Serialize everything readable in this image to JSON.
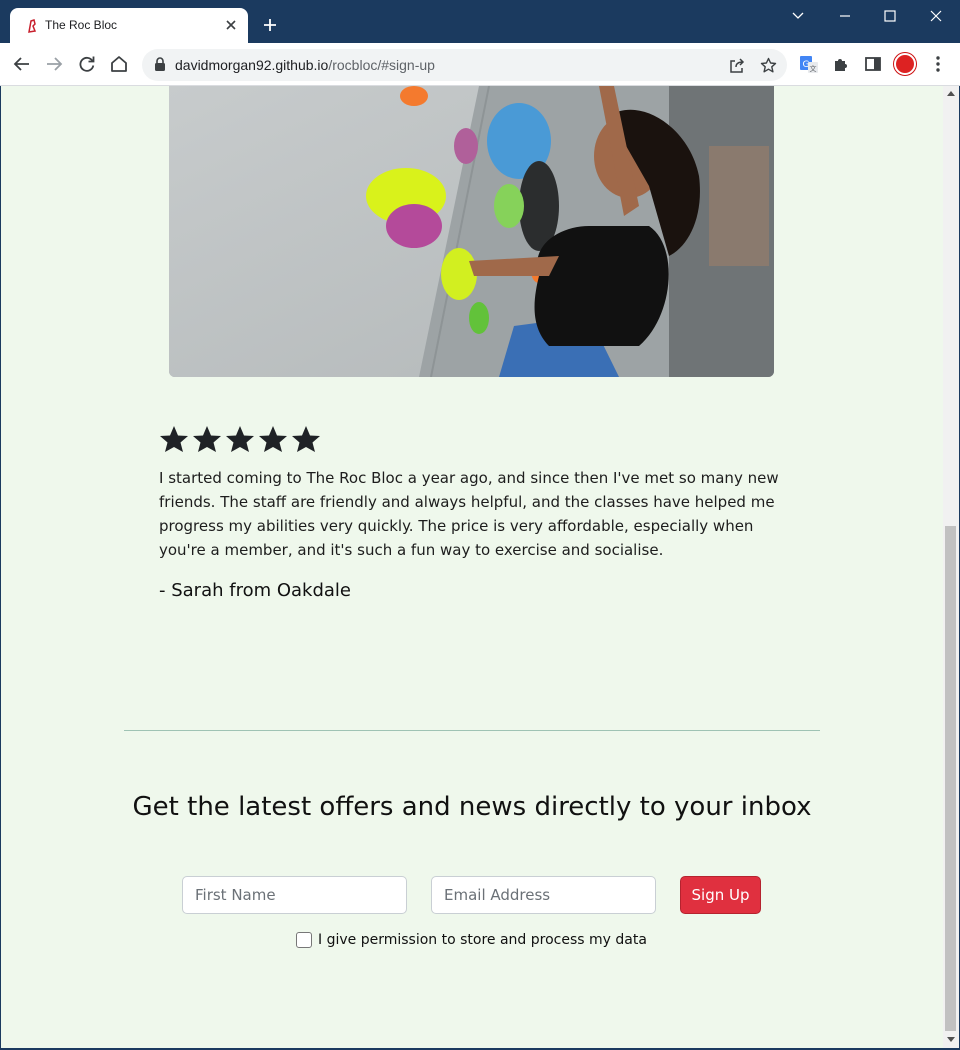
{
  "browser": {
    "tab_title": "The Roc Bloc",
    "url_host": "davidmorgan92.github.io",
    "url_path": "/rocbloc/#sign-up"
  },
  "testimonial": {
    "rating": 5,
    "text": "I started coming to The Roc Bloc a year ago, and since then I've met so many new friends. The staff are friendly and always helpful, and the classes have helped me progress my abilities very quickly. The price is very affordable, especially when you're a member, and it's such a fun way to exercise and socialise.",
    "author": "- Sarah from Oakdale"
  },
  "signup": {
    "heading": "Get the latest offers and news directly to your inbox",
    "first_name_placeholder": "First Name",
    "email_placeholder": "Email Address",
    "button_label": "Sign Up",
    "consent_label": "I give permission to store and process my data"
  },
  "colors": {
    "page_bg": "#eff8ec",
    "accent": "#e0303f",
    "titlebar": "#1b3a5f"
  },
  "icons": [
    "back-icon",
    "forward-icon",
    "reload-icon",
    "home-icon",
    "lock-icon",
    "share-icon",
    "bookmark-star-icon",
    "translate-icon",
    "extensions-icon",
    "side-panel-icon",
    "kebab-menu-icon",
    "star-icon"
  ]
}
